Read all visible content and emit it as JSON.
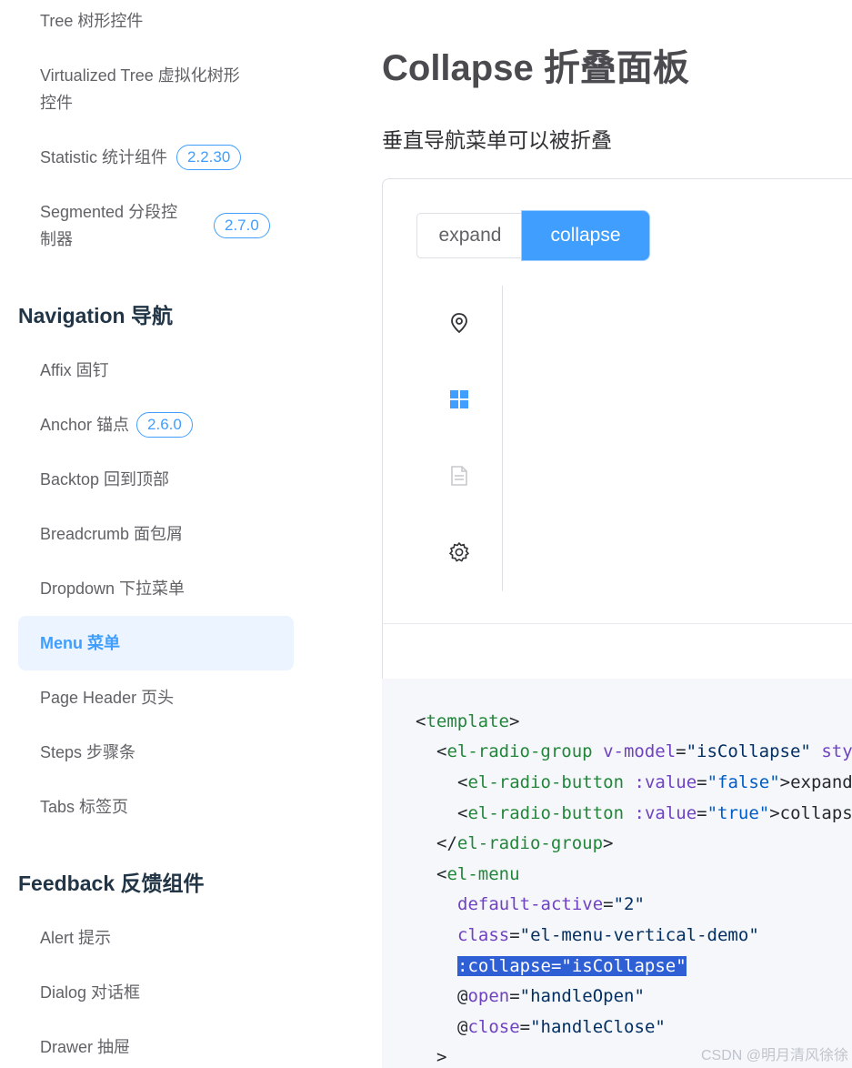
{
  "sidebar": {
    "items": [
      {
        "label": "Tree 树形控件"
      },
      {
        "label": "Virtualized Tree 虚拟化树形",
        "label2": "控件"
      },
      {
        "label": "Statistic 统计组件",
        "badge": "2.2.30"
      },
      {
        "label": "Segmented 分段控",
        "label2": "制器",
        "badge": "2.7.0"
      }
    ],
    "group_navigation": "Navigation 导航",
    "nav_items": [
      {
        "label": "Affix 固钉"
      },
      {
        "label": "Anchor 锚点",
        "badge": "2.6.0"
      },
      {
        "label": "Backtop 回到顶部"
      },
      {
        "label": "Breadcrumb 面包屑"
      },
      {
        "label": "Dropdown 下拉菜单"
      },
      {
        "label": "Menu 菜单"
      },
      {
        "label": "Page Header 页头"
      },
      {
        "label": "Steps 步骤条"
      },
      {
        "label": "Tabs 标签页"
      }
    ],
    "group_feedback": "Feedback 反馈组件",
    "feedback_items": [
      {
        "label": "Alert 提示"
      },
      {
        "label": "Dialog 对话框"
      },
      {
        "label": "Drawer 抽屉"
      }
    ]
  },
  "main": {
    "title": "Collapse 折叠面板",
    "description": "垂直导航菜单可以被折叠",
    "radio": {
      "expand": "expand",
      "collapse": "collapse",
      "selected": "collapse"
    },
    "menu_icons": [
      "location-icon",
      "grid-menu-icon",
      "document-icon",
      "setting-icon"
    ],
    "code": {
      "l1_open": "<",
      "l1_tag": "template",
      "l1_close": ">",
      "l2_lt": "<",
      "l2_tag": "el-radio-group",
      "l2_attr": "v-model",
      "l2_eq": "=",
      "l2_val": "\"isCollapse\"",
      "l2_attr2": "sty",
      "l3_lt": "<",
      "l3_tag": "el-radio-button",
      "l3_attr": ":value",
      "l3_eq": "=",
      "l3_val": "\"false\"",
      "l3_text": ">expand",
      "l4_lt": "<",
      "l4_tag": "el-radio-button",
      "l4_attr": ":value",
      "l4_eq": "=",
      "l4_val": "\"true\"",
      "l4_text": ">collaps",
      "l5_lt": "</",
      "l5_tag": "el-radio-group",
      "l5_gt": ">",
      "l6_lt": "<",
      "l6_tag": "el-menu",
      "l7_attr": "default-active",
      "l7_eq": "=",
      "l7_val": "\"2\"",
      "l8_attr": "class",
      "l8_eq": "=",
      "l8_val": "\"el-menu-vertical-demo\"",
      "l9_text": ":collapse=\"isCollapse\"",
      "l10_at": "@",
      "l10_attr": "open",
      "l10_eq": "=",
      "l10_val": "\"handleOpen\"",
      "l11_at": "@",
      "l11_attr": "close",
      "l11_eq": "=",
      "l11_val": "\"handleClose\"",
      "l12_text": ">"
    }
  },
  "watermark": "CSDN @明月清风徐徐",
  "colors": {
    "accent": "#409eff",
    "active_bg": "#ecf5ff",
    "code_bg": "#f5f7fa",
    "highlight": "#2f5fd4"
  }
}
